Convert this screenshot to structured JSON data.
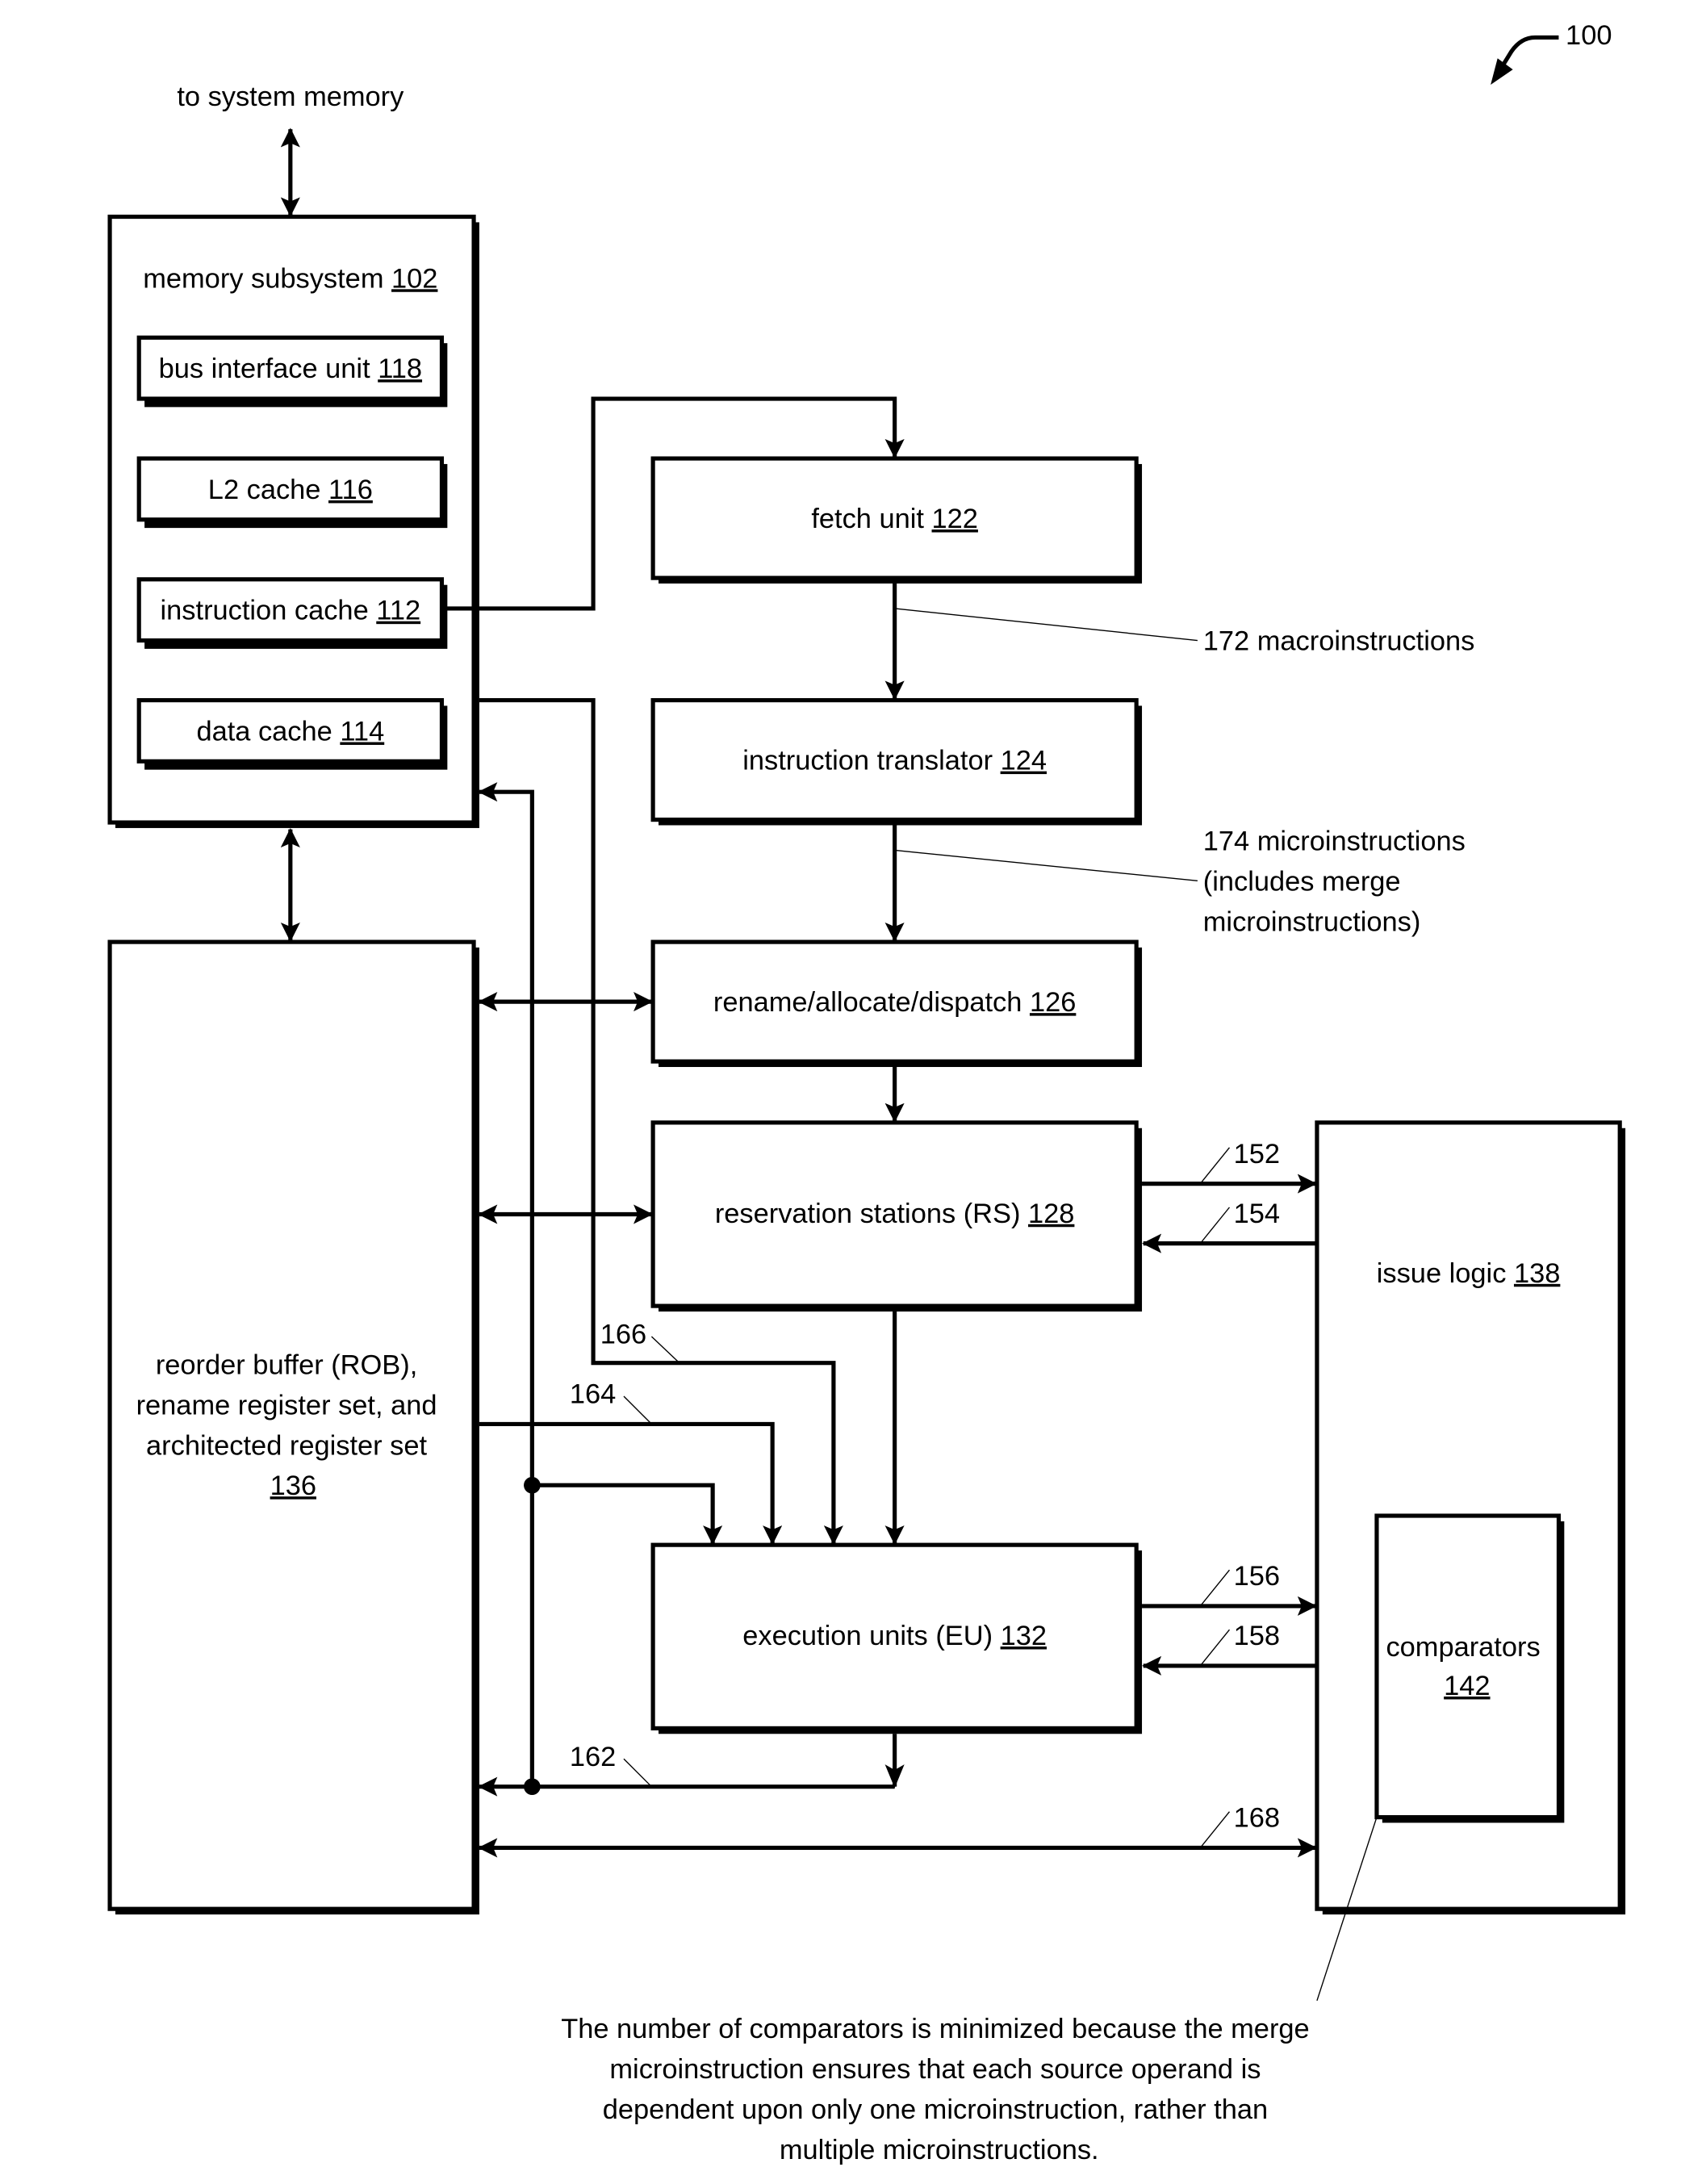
{
  "figure": {
    "ref": "100",
    "top_label": "to system memory"
  },
  "blocks": {
    "memory_subsystem": {
      "label": "memory subsystem ",
      "ref": "102"
    },
    "bus_interface_unit": {
      "label": "bus interface unit  ",
      "ref": "118"
    },
    "l2_cache": {
      "label": "L2 cache ",
      "ref": "116"
    },
    "instruction_cache": {
      "label": "instruction cache ",
      "ref": "112"
    },
    "data_cache": {
      "label": "data cache ",
      "ref": "114"
    },
    "fetch_unit": {
      "label": "fetch unit ",
      "ref": "122"
    },
    "instruction_translator": {
      "label": "instruction translator ",
      "ref": "124"
    },
    "rename_allocate_dispatch": {
      "label": "rename/allocate/dispatch ",
      "ref": "126"
    },
    "reservation_stations": {
      "label": "reservation stations (RS) ",
      "ref": "128"
    },
    "execution_units": {
      "label": "execution units (EU) ",
      "ref": "132"
    },
    "rob": {
      "lines": [
        "reorder buffer (ROB),",
        "rename register set, and",
        "architected register set"
      ],
      "ref": "136"
    },
    "issue_logic": {
      "label": "issue logic ",
      "ref": "138"
    },
    "comparators": {
      "label": "comparators",
      "ref": "142"
    }
  },
  "signals": {
    "macroinstructions": "172 macroinstructions",
    "microinstructions": [
      "174 microinstructions",
      "(includes merge",
      "microinstructions)"
    ],
    "s152": "152",
    "s154": "154",
    "s156": "156",
    "s158": "158",
    "s162": "162",
    "s164": "164",
    "s166": "166",
    "s168": "168"
  },
  "note": {
    "lines": [
      "The number of comparators is minimized because the merge",
      "microinstruction ensures that each source operand is",
      "dependent upon only one microinstruction, rather than",
      "multiple microinstructions."
    ]
  }
}
